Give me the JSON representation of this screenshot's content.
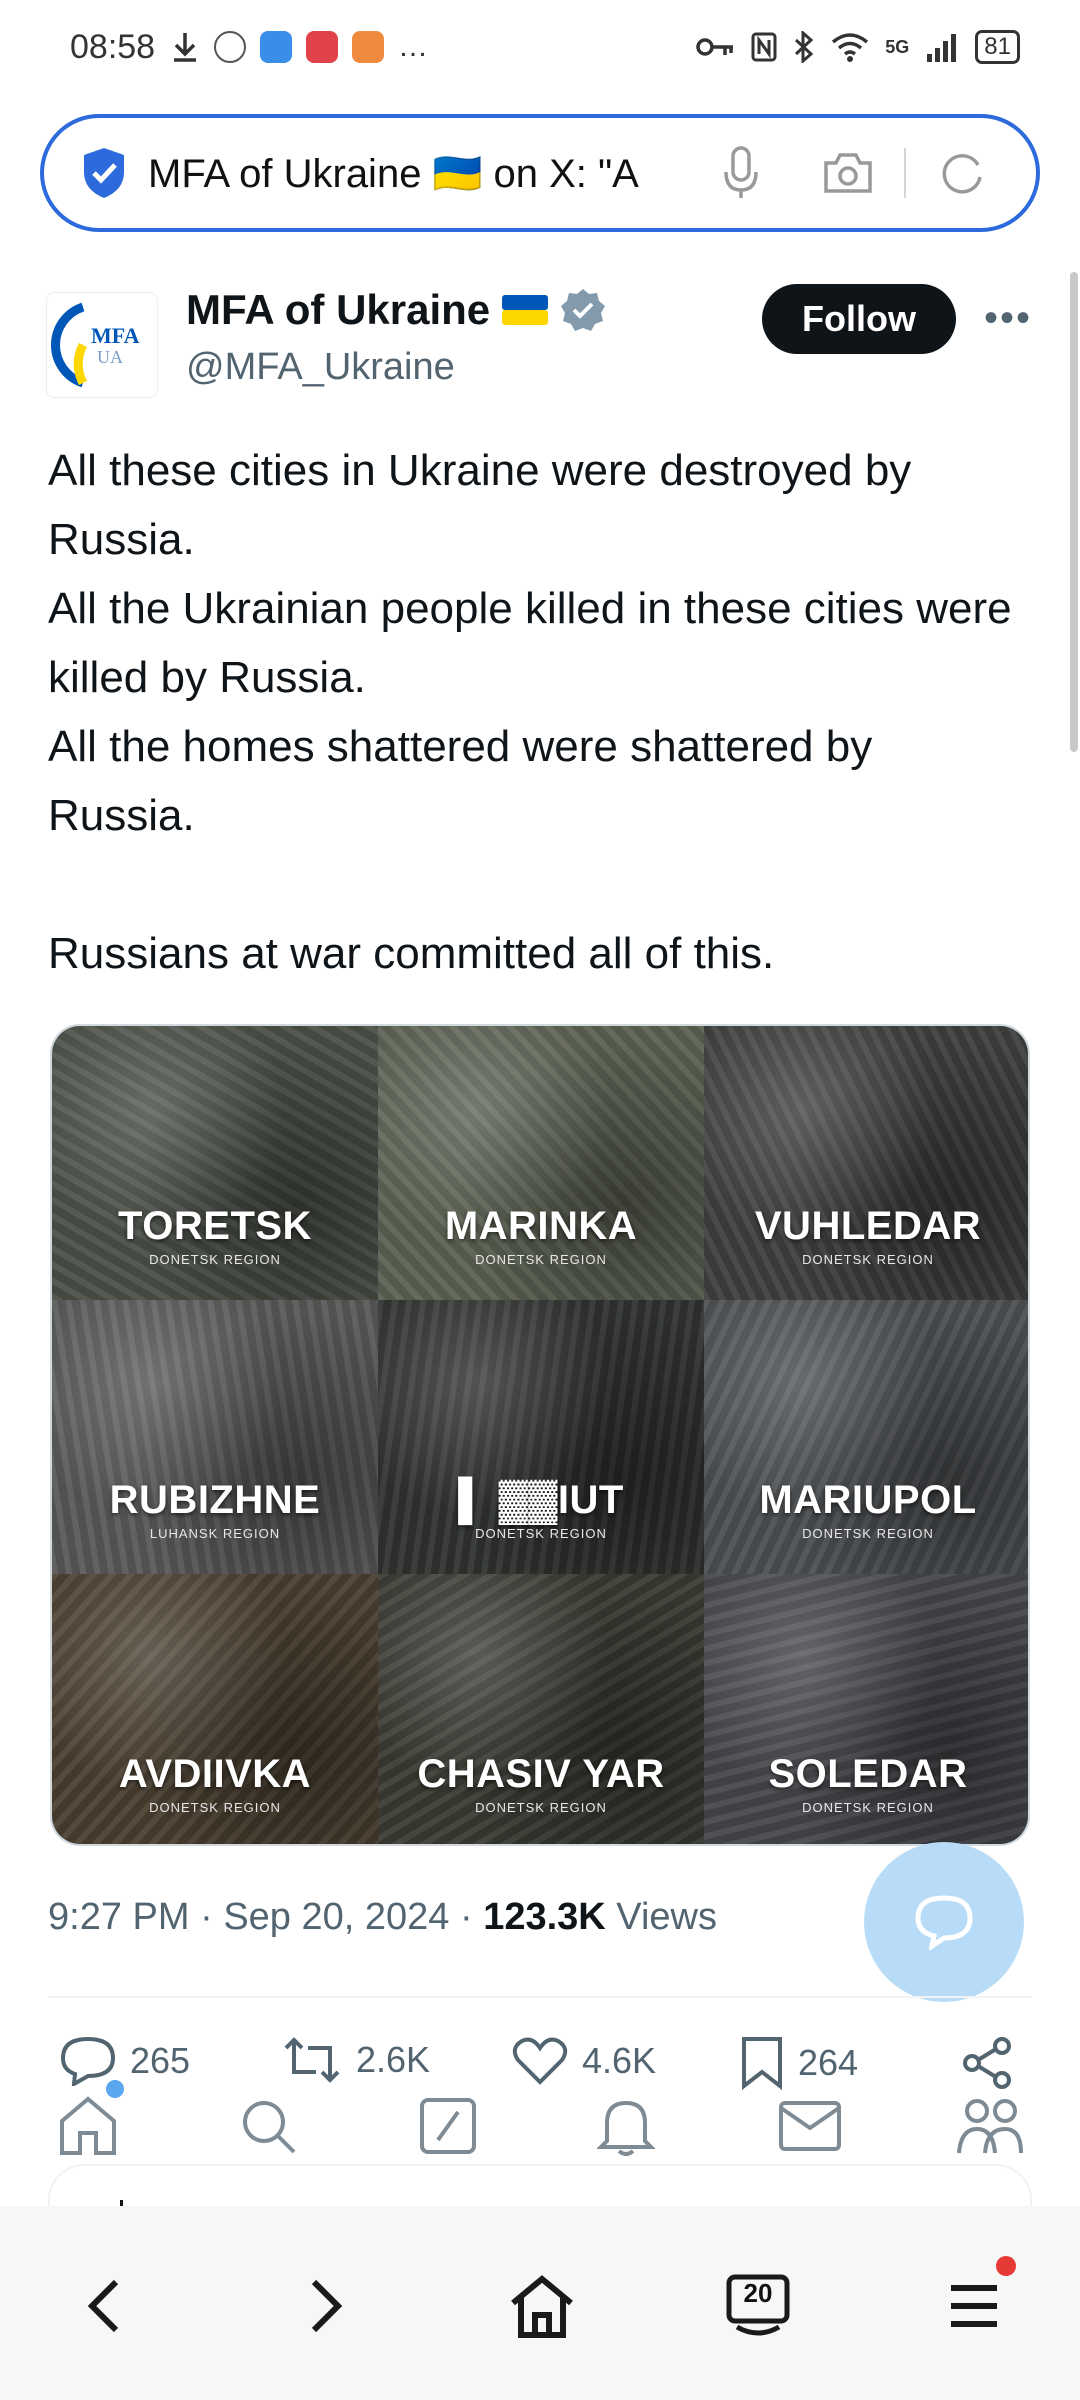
{
  "status_bar": {
    "time": "08:58",
    "battery": "81",
    "network": "5G",
    "overflow": "…"
  },
  "browser": {
    "url_text": "MFA of Ukraine 🇺🇦 on X: \"A",
    "tab_count": "20"
  },
  "tweet": {
    "author_name": "MFA of Ukraine",
    "author_flag": "🇺🇦",
    "handle": "@MFA_Ukraine",
    "avatar_text_top": "MFA",
    "avatar_text_bottom": "UA",
    "follow_label": "Follow",
    "more_label": "•••",
    "text": "All these cities in Ukraine were destroyed by Russia.\nAll the Ukrainian people killed in these cities were killed by Russia.\nAll the homes shattered were shattered by Russia.\n\nRussians at war committed all of this.",
    "time": "9:27 PM",
    "date": "Sep 20, 2024",
    "views_count": "123.3K",
    "views_label": "Views",
    "media_tiles": [
      {
        "city": "TORETSK",
        "region": "DONETSK REGION",
        "bg": "#4a4f47"
      },
      {
        "city": "MARINKA",
        "region": "DONETSK REGION",
        "bg": "#5b6152"
      },
      {
        "city": "VUHLEDAR",
        "region": "DONETSK REGION",
        "bg": "#3e3f3e"
      },
      {
        "city": "RUBIZHNE",
        "region": "LUHANSK REGION",
        "bg": "#585858"
      },
      {
        "city": "▌    ▓▓IUT",
        "region": "DONETSK REGION",
        "bg": "#2f322f"
      },
      {
        "city": "MARIUPOL",
        "region": "DONETSK REGION",
        "bg": "#4c4f52"
      },
      {
        "city": "AVDIIVKA",
        "region": "DONETSK REGION",
        "bg": "#4a3f30"
      },
      {
        "city": "CHASIV YAR",
        "region": "DONETSK REGION",
        "bg": "#3a3a33"
      },
      {
        "city": "SOLEDAR",
        "region": "DONETSK REGION",
        "bg": "#44464a"
      }
    ],
    "stats": {
      "replies": "265",
      "reposts": "2.6K",
      "likes": "4.6K",
      "bookmarks": "264"
    }
  },
  "colors": {
    "accent": "#2d6bdd",
    "fab": "#b8dcf7",
    "muted": "#536471",
    "ua_blue": "#0057b7",
    "ua_yellow": "#ffd700"
  }
}
